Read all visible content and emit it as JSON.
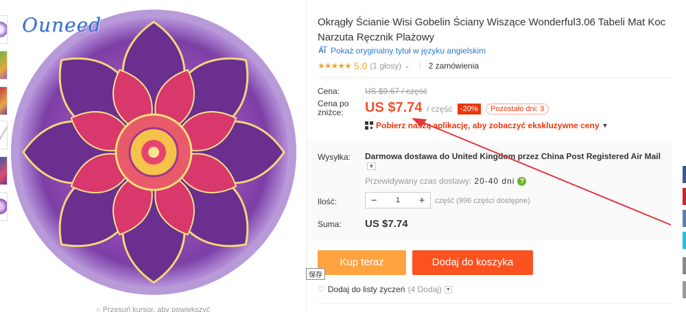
{
  "gallery": {
    "logo": "Ouneed",
    "zoom_hint": "Przesuń kursor, aby powiększyć"
  },
  "product": {
    "title": "Okrągły Ścianie Wisi Gobelin Ściany Wiszące Wonderful3.06 Tabeli Mat Koc Narzuta Ręcznik Plażowy",
    "show_original": "Pokaż oryginalny tytuł w języku angielskim",
    "rating_score": "5.0",
    "rating_votes": "(1 głosy)",
    "orders": "2 zamówienia"
  },
  "pricing": {
    "price_label": "Cena:",
    "old_price": "US $9.67 / część",
    "discount_label": "Cena po zniżce:",
    "price": "US $7.74",
    "per_unit": "/ część",
    "discount_pct": "-20%",
    "days_left": "Pozostało dni: 3",
    "app_promo": "Pobierz naszą aplikację, aby zobaczyć ekskluzywne ceny"
  },
  "shipping": {
    "label": "Wysyłka:",
    "text": "Darmowa dostawa do United Kingdom przez China Post Registered Air Mail",
    "eta_label": "Przewidywany czas dostawy:",
    "eta_value": "20-40 dni"
  },
  "quantity": {
    "label": "Ilość:",
    "value": "1",
    "minus": "−",
    "plus": "+",
    "available": "część (996 części dostępne)"
  },
  "total": {
    "label": "Suma:",
    "value": "US $7.74"
  },
  "actions": {
    "buy_now": "Kup teraz",
    "add_to_cart": "Dodaj do koszyka",
    "save_tooltip": "保存",
    "wishlist": "Dodaj do listy życzeń",
    "wishlist_count": "(4 Dodaj)"
  },
  "icons": {
    "translate": "translate-icon",
    "qr": "qr-code-icon",
    "help": "help-icon",
    "heart": "heart-icon"
  },
  "colors": {
    "price": "#f0502d",
    "buy_now": "#fea33e",
    "add_to_cart": "#fb5220",
    "stars": "#f5a623",
    "link": "#2f79cc",
    "annotation_arrow": "#e8343c"
  }
}
